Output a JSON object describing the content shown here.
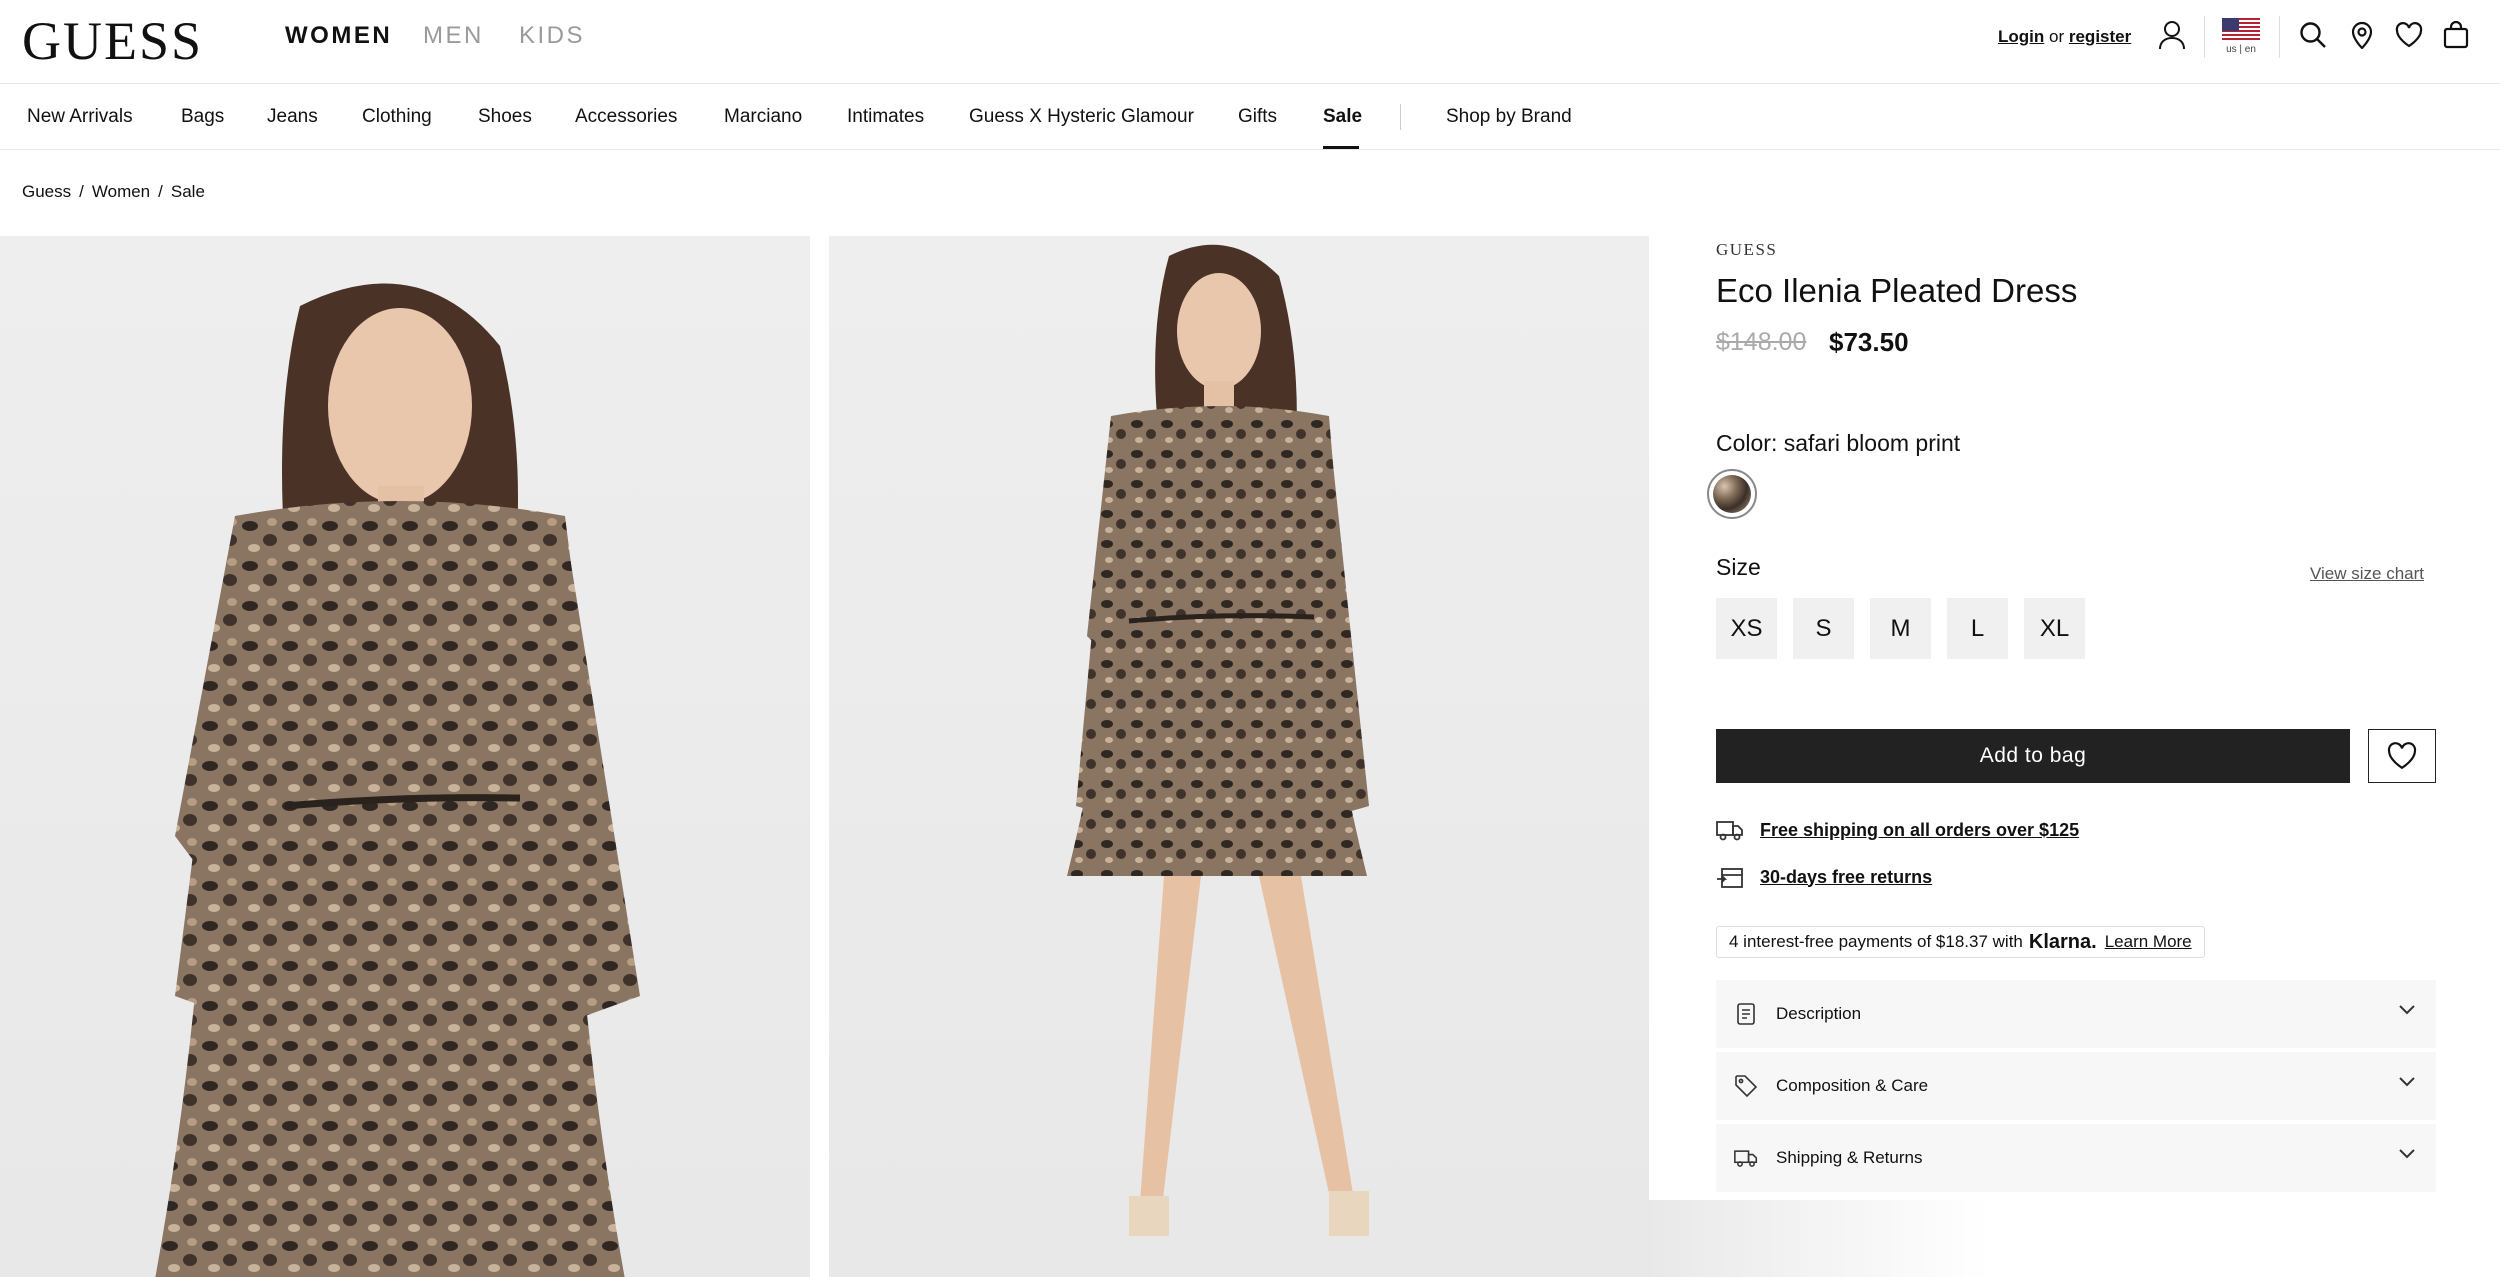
{
  "header": {
    "logo": "GUESS",
    "genders": [
      "WOMEN",
      "MEN",
      "KIDS"
    ],
    "login": "Login",
    "or": "or",
    "register": "register",
    "locale": "us | en"
  },
  "nav": {
    "items": [
      "New Arrivals",
      "Bags",
      "Jeans",
      "Clothing",
      "Shoes",
      "Accessories",
      "Marciano",
      "Intimates",
      "Guess X Hysteric Glamour",
      "Gifts",
      "Sale"
    ],
    "shop_by_brand": "Shop by Brand"
  },
  "breadcrumb": [
    "Guess",
    "Women",
    "Sale"
  ],
  "product": {
    "brand": "GUESS",
    "title": "Eco Ilenia Pleated Dress",
    "price_original": "$148.00",
    "price_sale": "$73.50",
    "color_label": "Color: safari bloom print",
    "size_label": "Size",
    "size_chart": "View size chart",
    "sizes": [
      "XS",
      "S",
      "M",
      "L",
      "XL"
    ],
    "add_to_bag": "Add to bag"
  },
  "perks": {
    "shipping": "Free shipping on all orders over $125",
    "returns": "30-days free returns"
  },
  "klarna": {
    "text": "4 interest-free payments of $18.37 with",
    "brand": "Klarna.",
    "learn_more": "Learn More"
  },
  "accordion": [
    "Description",
    "Composition & Care",
    "Shipping & Returns"
  ]
}
